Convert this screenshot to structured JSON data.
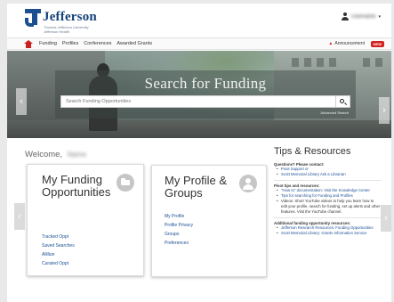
{
  "header": {
    "brand": "Jefferson",
    "brand_sub1": "Thomas Jefferson University",
    "brand_sub2": "Jefferson Health",
    "user_name": "Username"
  },
  "nav": {
    "items": [
      "Funding",
      "Profiles",
      "Conferences",
      "Awarded Grants"
    ],
    "announcements_label": "Announcement",
    "badge": "NEW"
  },
  "hero": {
    "title": "Search for Funding",
    "search_placeholder": "Search Funding Opportunities",
    "advanced_search": "Advanced Search"
  },
  "welcome": {
    "label": "Welcome,",
    "name": "Name"
  },
  "card_funding": {
    "title": "My Funding Opportunities",
    "links": [
      "Tracked Oppt",
      "Saved Searches",
      "Alliliun",
      "Curated Oppt"
    ]
  },
  "card_profile": {
    "title": "My Profile & Groups",
    "links": [
      "My Profile",
      "Profile Privacy",
      "Groups",
      "Preferences"
    ]
  },
  "tips": {
    "title": "Tips & Resources",
    "sections": [
      {
        "heading": "Questions? Please contact:",
        "items": [
          "Pivot Support or",
          "Scott Memorial Library Ask a Librarian"
        ]
      },
      {
        "heading": "Pivot tips and resources:",
        "items": [
          "\"How to\" documentation: Visit the Knowledge Center",
          "Tips for searching for Funding and Profiles",
          "Videos: Short YouTube videos to help you learn how to edit your profile, search for funding, set up alerts and other features. Visit the YouTube channel."
        ]
      },
      {
        "heading": "Additional funding opportunity resources:",
        "items": [
          "Jefferson Research Resources: Funding Opportunities",
          "Scott Memorial Library: Grants Information Service"
        ]
      }
    ]
  },
  "colors": {
    "brand_blue": "#15427a",
    "accent_red": "#cc1f1f",
    "link_blue": "#1a4f94"
  }
}
